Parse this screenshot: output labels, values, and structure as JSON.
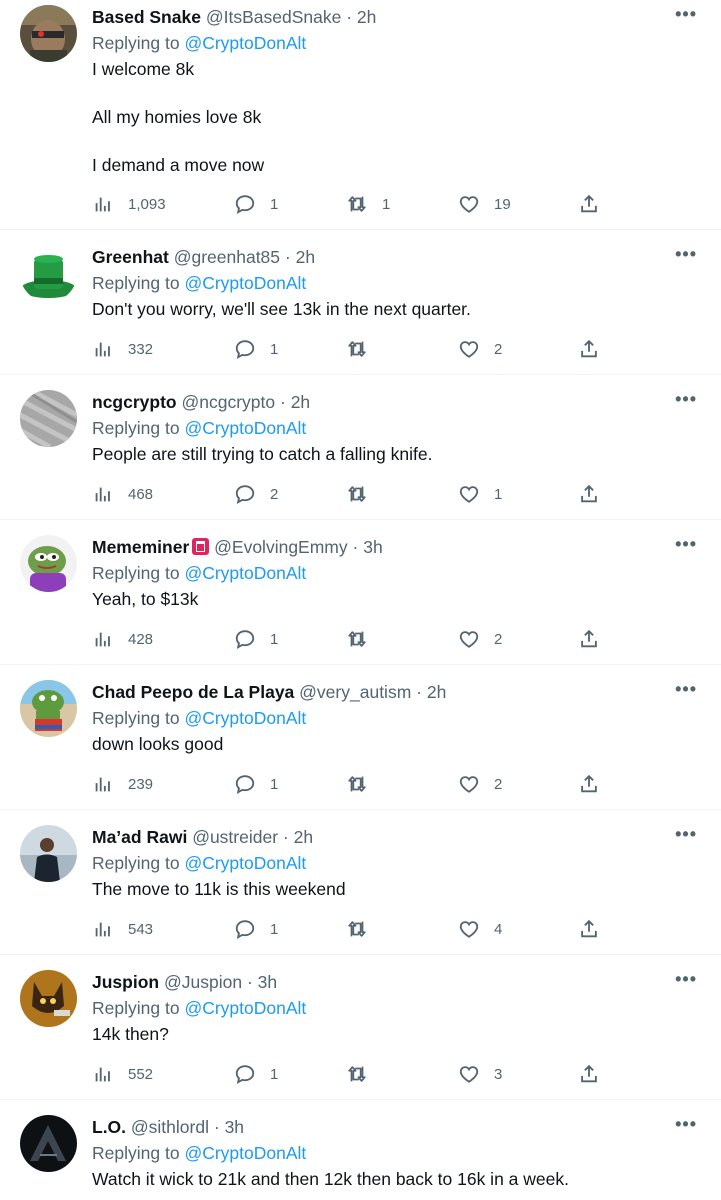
{
  "tweets": [
    {
      "name": "Based Snake",
      "handle": "@ItsBasedSnake",
      "dot": "·",
      "time": "2h",
      "reply_prefix": "Replying to",
      "reply_to": "@CryptoDonAlt",
      "lines": [
        "I welcome 8k",
        "All my homies love 8k",
        "I demand a move now"
      ],
      "views": "1,093",
      "replies": "1",
      "retweets": "1",
      "likes": "19",
      "avatar": "snake-avatar"
    },
    {
      "name": "Greenhat",
      "handle": "@greenhat85",
      "dot": "·",
      "time": "2h",
      "reply_prefix": "Replying to",
      "reply_to": "@CryptoDonAlt",
      "lines": [
        "Don't you worry, we'll see 13k in the next quarter."
      ],
      "views": "332",
      "replies": "1",
      "retweets": "",
      "likes": "2",
      "avatar": "green-hat-avatar"
    },
    {
      "name": "ncgcrypto",
      "handle": "@ncgcrypto",
      "dot": "·",
      "time": "2h",
      "reply_prefix": "Replying to",
      "reply_to": "@CryptoDonAlt",
      "lines": [
        "People are still trying to catch a falling knife."
      ],
      "views": "468",
      "replies": "2",
      "retweets": "",
      "likes": "1",
      "avatar": "grey-texture-avatar"
    },
    {
      "name": "Mememiner",
      "handle": "@EvolvingEmmy",
      "dot": "·",
      "time": "3h",
      "reply_prefix": "Replying to",
      "reply_to": "@CryptoDonAlt",
      "lines": [
        "Yeah, to $13k"
      ],
      "views": "428",
      "replies": "1",
      "retweets": "",
      "likes": "2",
      "avatar": "pepe-avatar",
      "badge_icon": "red-square-badge-icon"
    },
    {
      "name": "Chad Peepo de La Playa",
      "handle": "@very_autism",
      "dot": "·",
      "time": "2h",
      "reply_prefix": "Replying to",
      "reply_to": "@CryptoDonAlt",
      "lines": [
        "down looks good"
      ],
      "views": "239",
      "replies": "1",
      "retweets": "",
      "likes": "2",
      "avatar": "peepo-beach-avatar"
    },
    {
      "name": "Ma’ad Rawi",
      "handle": "@ustreider",
      "dot": "·",
      "time": "2h",
      "reply_prefix": "Replying to",
      "reply_to": "@CryptoDonAlt",
      "lines": [
        "The move to 11k is this weekend"
      ],
      "views": "543",
      "replies": "1",
      "retweets": "",
      "likes": "4",
      "avatar": "person-photo-avatar"
    },
    {
      "name": "Juspion",
      "handle": "@Juspion",
      "dot": "·",
      "time": "3h",
      "reply_prefix": "Replying to",
      "reply_to": "@CryptoDonAlt",
      "lines": [
        "14k then?"
      ],
      "views": "552",
      "replies": "1",
      "retweets": "",
      "likes": "3",
      "avatar": "fox-avatar"
    },
    {
      "name": "L.O.",
      "handle": "@sithlordl",
      "dot": "·",
      "time": "3h",
      "reply_prefix": "Replying to",
      "reply_to": "@CryptoDonAlt",
      "lines": [
        "Watch it wick to 21k and then 12k then back to 16k in a week."
      ],
      "views": "",
      "replies": "",
      "retweets": "",
      "likes": "",
      "avatar": "dark-logo-avatar"
    }
  ],
  "more_icon": "more-options-icon",
  "colors": {
    "link": "#1d9bf0",
    "secondary": "#536471",
    "text": "#0f1419",
    "divider": "#eff3f4"
  }
}
